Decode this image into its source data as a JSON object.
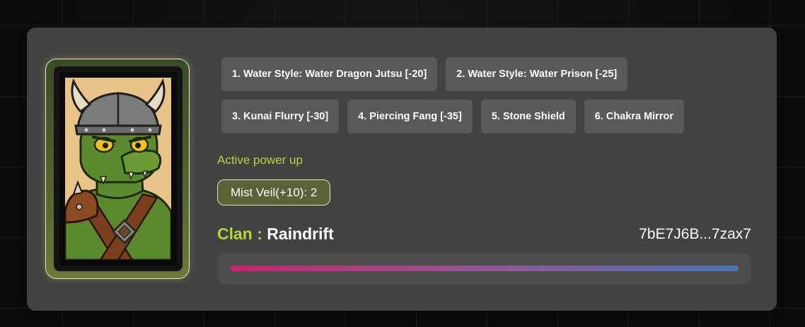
{
  "character": {
    "portrait_icon": "viking-crocodile-warrior-icon"
  },
  "moves": [
    {
      "label": "1. Water Style: Water Dragon Jutsu [-20]"
    },
    {
      "label": "2. Water Style: Water Prison [-25]"
    },
    {
      "label": "3. Kunai Flurry [-30]"
    },
    {
      "label": "4. Piercing Fang [-35]"
    },
    {
      "label": "5. Stone Shield"
    },
    {
      "label": "6. Chakra Mirror"
    }
  ],
  "powerup": {
    "heading": "Active power up",
    "badge": "Mist Veil(+10): 2"
  },
  "clan": {
    "label": "Clan",
    "separator": " : ",
    "name": "Raindrift"
  },
  "wallet_address": "7bE7J6B...7zax7",
  "health": {
    "fraction": 1.0
  },
  "colors": {
    "accent": "#b4d639",
    "panel": "#424242",
    "button": "#595959",
    "bar_start": "#c5266f",
    "bar_end": "#4a74b5"
  }
}
